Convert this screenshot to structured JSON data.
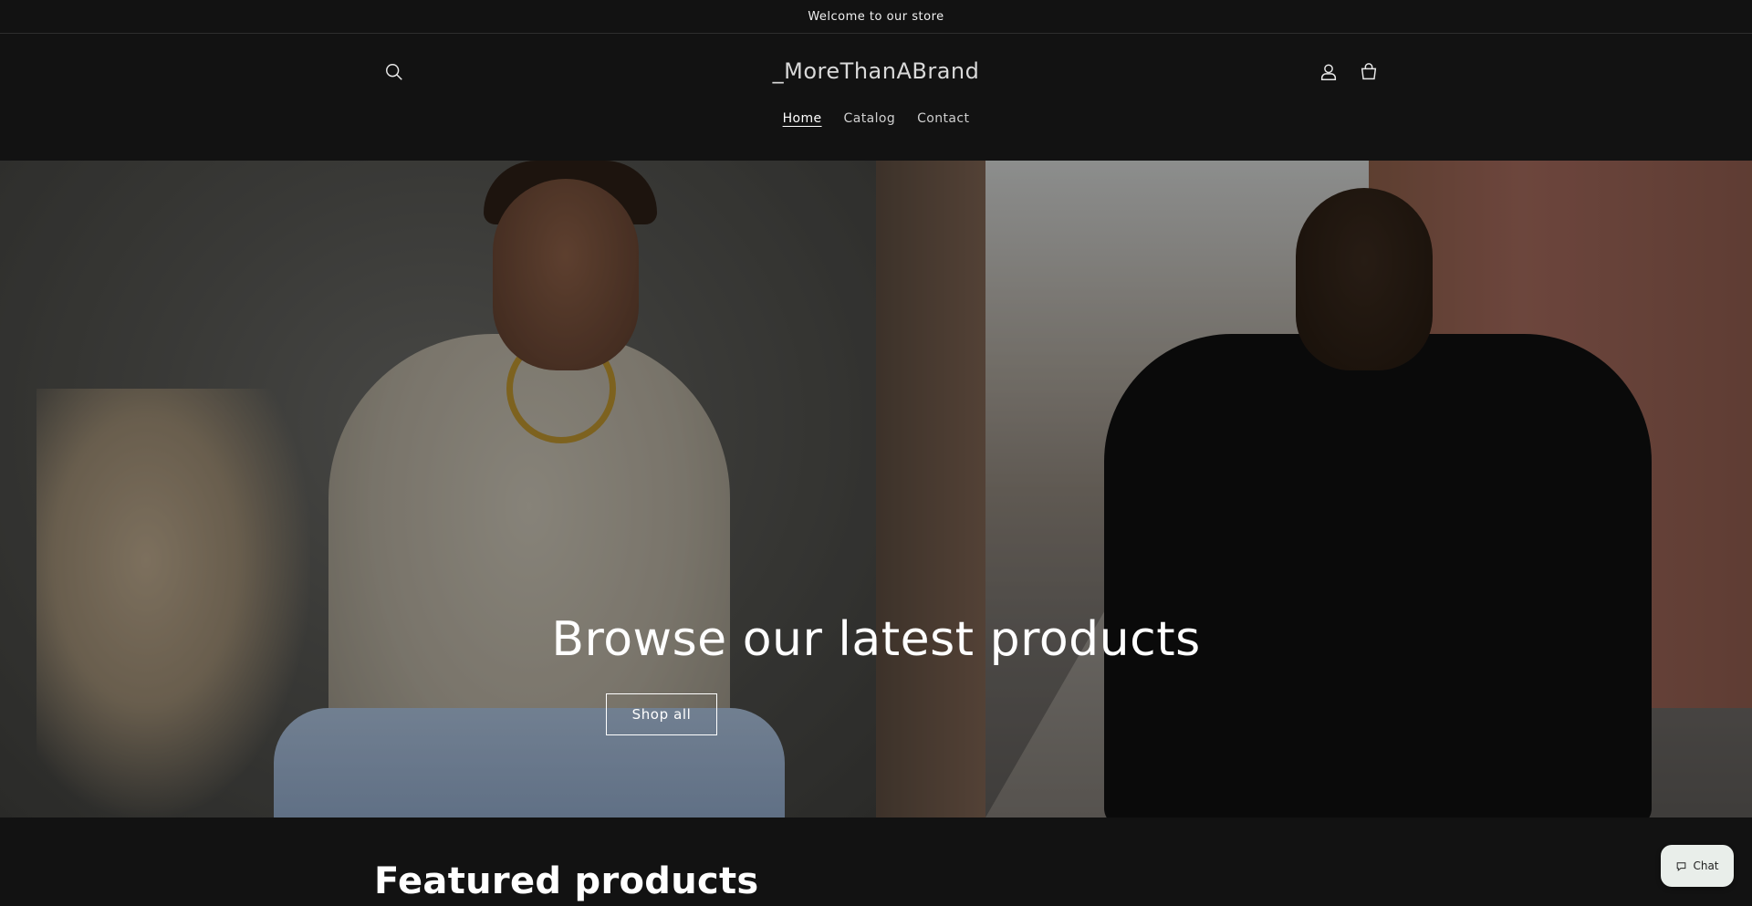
{
  "announcement": {
    "text": "Welcome to our store"
  },
  "header": {
    "logo": "_MoreThanABrand",
    "nav": [
      {
        "label": "Home",
        "active": true
      },
      {
        "label": "Catalog",
        "active": false
      },
      {
        "label": "Contact",
        "active": false
      }
    ],
    "icons": {
      "search": "search-icon",
      "account": "account-icon",
      "cart": "cart-icon"
    }
  },
  "hero": {
    "heading": "Browse our latest products",
    "button_label": "Shop all"
  },
  "featured": {
    "title": "Featured products"
  },
  "chat": {
    "label": "Chat",
    "icon": "chat-bubble-icon"
  },
  "colors": {
    "background": "#121212",
    "text": "#ffffff",
    "shirt_print": "#7f9fd3"
  }
}
